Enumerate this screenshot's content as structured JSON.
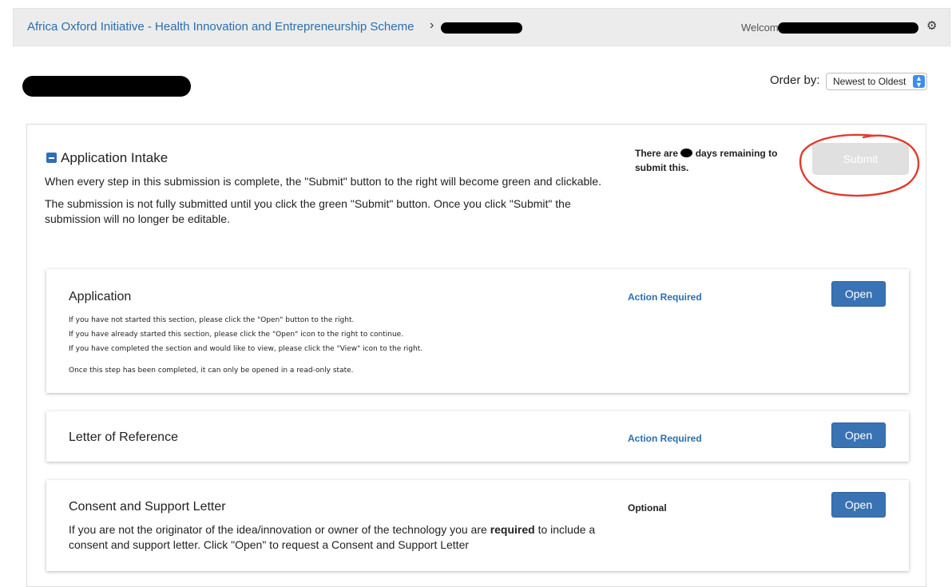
{
  "header": {
    "breadcrumb_link": "Africa Oxford Initiative - Health Innovation and Entrepreneurship Scheme",
    "breadcrumb_separator": "›",
    "welcome_prefix": "Welcome,",
    "gear_icon": "gear-icon"
  },
  "order": {
    "label": "Order by:",
    "selected": "Newest to Oldest"
  },
  "intake": {
    "title": "Application Intake",
    "description_1": "When every step in this submission is complete, the \"Submit\" button to the right will become green and clickable.",
    "description_2": "The submission is not fully submitted until you click the green \"Submit\" button. Once you click \"Submit\" the submission will no longer be editable.",
    "days_prefix": "There are",
    "days_suffix": "days remaining to submit this.",
    "submit_label": "Submit"
  },
  "cards": [
    {
      "title": "Application",
      "status": "Action Required",
      "button": "Open",
      "lines": [
        "If you have not started this section, please click the \"Open\" button to the right.",
        "If you have already started this section, please click the \"Open\" icon to the right to continue.",
        "If you have completed the section and would like to view, please click the \"View\" icon to the right."
      ],
      "note": "Once this step has been completed, it can only be opened in a read-only state."
    },
    {
      "title": "Letter of Reference",
      "status": "Action Required",
      "button": "Open"
    },
    {
      "title": "Consent and Support Letter",
      "status": "Optional",
      "button": "Open",
      "desc_before": "If you are not the originator of the idea/innovation or owner of the technology you are ",
      "desc_bold": "required",
      "desc_after": " to include a consent and support letter. Click \"Open\" to request a Consent and Support Letter"
    }
  ],
  "colors": {
    "link": "#2a6fae",
    "button": "#3a73b3",
    "annotation": "#e23a2b",
    "submit_disabled": "#e0e0e0"
  }
}
